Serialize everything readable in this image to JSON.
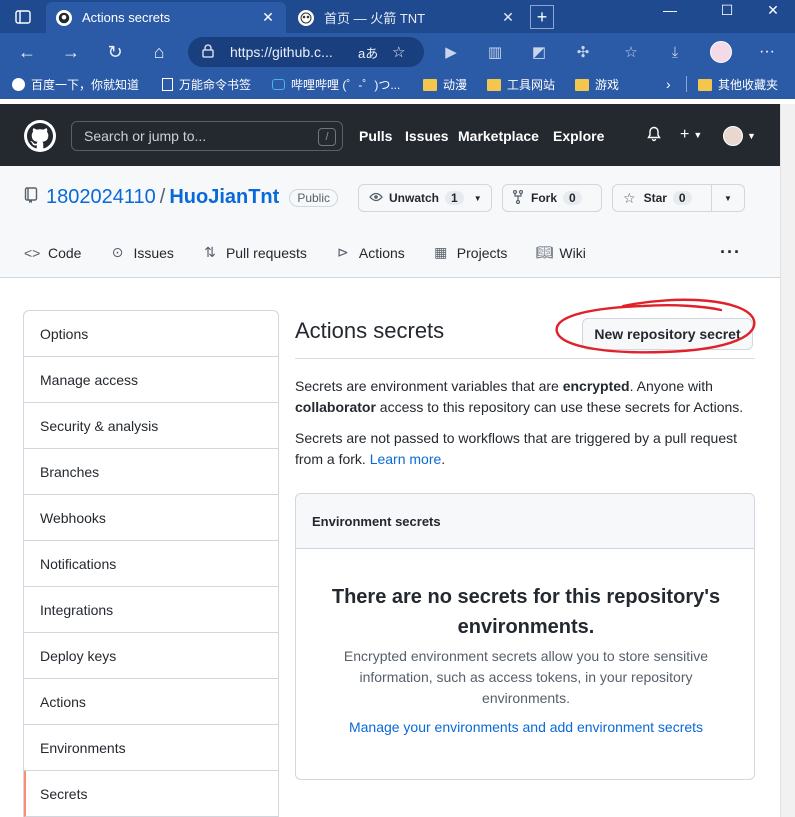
{
  "browser": {
    "tabs": [
      {
        "title": "Actions secrets",
        "active": true
      },
      {
        "title": "首页 — 火箭 TNT",
        "active": false
      }
    ],
    "url": "https://github.c...",
    "read_aloud": "aあ",
    "bookmarks": [
      "百度一下，你就知道",
      "万能命令书签",
      "哔哩哔哩 (゜-゜)つ...",
      "动漫",
      "工具网站",
      "游戏",
      "其他收藏夹"
    ]
  },
  "github": {
    "search_placeholder": "Search or jump to...",
    "search_shortcut": "/",
    "nav": [
      "Pulls",
      "Issues",
      "Marketplace",
      "Explore"
    ]
  },
  "repo": {
    "owner": "1802024110",
    "separator": "/",
    "name": "HuoJianTnt",
    "visibility": "Public",
    "unwatch_label": "Unwatch",
    "unwatch_count": "1",
    "fork_label": "Fork",
    "fork_count": "0",
    "star_label": "Star",
    "star_count": "0",
    "tabs": [
      {
        "label": "Code",
        "icon": "code-icon"
      },
      {
        "label": "Issues",
        "icon": "issue-icon"
      },
      {
        "label": "Pull requests",
        "icon": "pull-request-icon"
      },
      {
        "label": "Actions",
        "icon": "play-icon"
      },
      {
        "label": "Projects",
        "icon": "project-icon"
      },
      {
        "label": "Wiki",
        "icon": "book-icon"
      }
    ]
  },
  "sidebar": {
    "items": [
      "Options",
      "Manage access",
      "Security & analysis",
      "Branches",
      "Webhooks",
      "Notifications",
      "Integrations",
      "Deploy keys",
      "Actions",
      "Environments",
      "Secrets"
    ],
    "selected": "Secrets"
  },
  "main": {
    "title": "Actions secrets",
    "new_secret_label": "New repository secret",
    "intro_1": "Secrets are environment variables that are",
    "intro_bold_1": "encrypted",
    "intro_2": ". Anyone with",
    "intro_bold_2": "collaborator",
    "intro_3": "access to this repository can use these secrets for Actions.",
    "note": "Secrets are not passed to workflows that are triggered by a pull request from a fork.",
    "learn_more": "Learn more",
    "period": ".",
    "env_header": "Environment secrets",
    "blank_title": "There are no secrets for this repository's environments.",
    "blank_desc": "Encrypted environment secrets allow you to store sensitive information, such as access tokens, in your repository environments.",
    "blank_link": "Manage your environments and add environment secrets"
  },
  "colors": {
    "link": "#0969da",
    "header": "#24292f",
    "selected_marker": "#fd8c73",
    "annotation": "#e0212a"
  }
}
